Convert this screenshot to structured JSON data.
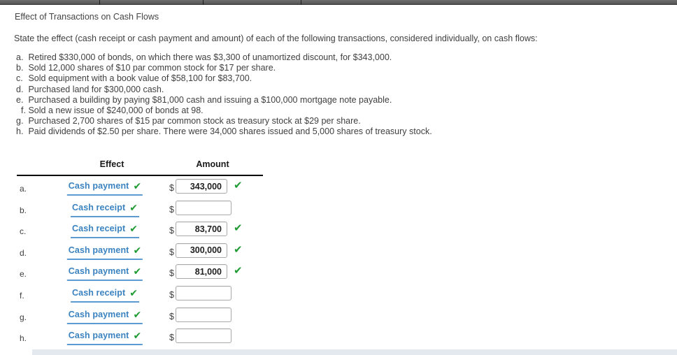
{
  "browser_chrome": {
    "tab_divider_positions": [
      142,
      290,
      430
    ]
  },
  "question": {
    "title": "Effect of Transactions on Cash Flows",
    "prompt": "State the effect (cash receipt or cash payment and amount) of each of the following transactions, considered individually, on cash flows:",
    "transactions": [
      {
        "label": "a.",
        "text": "Retired $330,000 of bonds, on which there was $3,300 of unamortized discount, for $343,000."
      },
      {
        "label": "b.",
        "text": "Sold 12,000 shares of $10 par common stock for $17 per share."
      },
      {
        "label": "c.",
        "text": "Sold equipment with a book value of $58,100 for $83,700."
      },
      {
        "label": "d.",
        "text": "Purchased land for $300,000 cash."
      },
      {
        "label": "e.",
        "text": "Purchased a building by paying $81,000 cash and issuing a $100,000 mortgage note payable."
      },
      {
        "label": "f.",
        "text": "Sold a new issue of $240,000 of bonds at 98."
      },
      {
        "label": "g.",
        "text": "Purchased 2,700 shares of $15 par common stock as treasury stock at $29 per share."
      },
      {
        "label": "h.",
        "text": "Paid dividends of $2.50 per share. There were 34,000 shares issued and 5,000 shares of treasury stock."
      }
    ]
  },
  "answer_table": {
    "headers": {
      "effect": "Effect",
      "amount": "Amount"
    },
    "currency_symbol": "$",
    "check_glyph": "✔",
    "colors": {
      "effect_text": "#3b83c0",
      "effect_underline": "#5b9bd1",
      "check_green": "#1f9b34",
      "header_rule": "#000000"
    },
    "rows": [
      {
        "letter": "a.",
        "effect": "Cash payment",
        "effect_checked": true,
        "amount": "343,000",
        "amount_checked": true
      },
      {
        "letter": "b.",
        "effect": "Cash receipt",
        "effect_checked": true,
        "amount": "",
        "amount_checked": false
      },
      {
        "letter": "c.",
        "effect": "Cash receipt",
        "effect_checked": true,
        "amount": "83,700",
        "amount_checked": true
      },
      {
        "letter": "d.",
        "effect": "Cash payment",
        "effect_checked": true,
        "amount": "300,000",
        "amount_checked": true
      },
      {
        "letter": "e.",
        "effect": "Cash payment",
        "effect_checked": true,
        "amount": "81,000",
        "amount_checked": true
      },
      {
        "letter": "f.",
        "effect": "Cash receipt",
        "effect_checked": true,
        "amount": "",
        "amount_checked": false
      },
      {
        "letter": "g.",
        "effect": "Cash payment",
        "effect_checked": true,
        "amount": "",
        "amount_checked": false
      },
      {
        "letter": "h.",
        "effect": "Cash payment",
        "effect_checked": true,
        "amount": "",
        "amount_checked": false
      }
    ]
  }
}
